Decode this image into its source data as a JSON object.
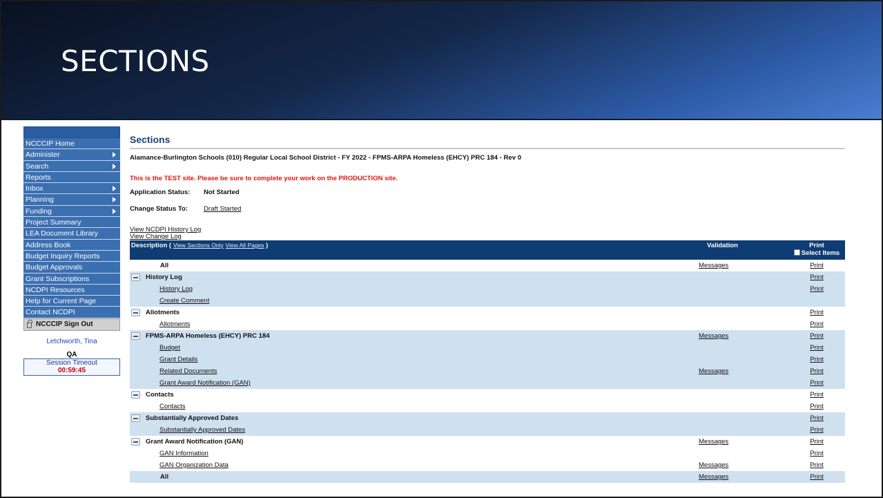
{
  "banner": {
    "title": "SECTIONS"
  },
  "sidebar": {
    "items": [
      {
        "label": "NCCCIP Home",
        "arrow": false
      },
      {
        "label": "Administer",
        "arrow": true
      },
      {
        "label": "Search",
        "arrow": true
      },
      {
        "label": "Reports",
        "arrow": false
      },
      {
        "label": "Inbox",
        "arrow": true
      },
      {
        "label": "Planning",
        "arrow": true
      },
      {
        "label": "Funding",
        "arrow": true
      },
      {
        "label": "Project Summary",
        "arrow": false
      },
      {
        "label": "LEA Document Library",
        "arrow": false
      },
      {
        "label": "Address Book",
        "arrow": false
      },
      {
        "label": "Budget Inquiry Reports",
        "arrow": false
      },
      {
        "label": "Budget Approvals",
        "arrow": false
      },
      {
        "label": "Grant Subscriptions",
        "arrow": false
      },
      {
        "label": "NCDPI Resources",
        "arrow": false
      },
      {
        "label": "Help for Current Page",
        "arrow": false
      },
      {
        "label": "Contact NCDPI",
        "arrow": false
      }
    ],
    "sign_out": "NCCCIP Sign Out",
    "user": "Letchworth, Tina",
    "env": "QA",
    "session_label": "Session Timeout",
    "session_time": "00:59:45"
  },
  "main": {
    "title": "Sections",
    "subtitle": "Alamance-Burlington Schools (010) Regular Local School District - FY 2022 - FPMS-ARPA Homeless (EHCY) PRC 184 - Rev 0",
    "test_warning": "This is the TEST site. Please be sure to complete your work on the PRODUCTION site.",
    "app_status_label": "Application Status:",
    "app_status_value": "Not Started",
    "change_status_label": "Change Status To:",
    "change_status_link": "Draft Started",
    "history_log_link": "View NCDPI History Log",
    "change_log_link": "View Change Log"
  },
  "table": {
    "headers": {
      "description": "Description",
      "view_sections_only": "View Sections Only",
      "view_all_pages": "View All Pages",
      "validation": "Validation",
      "print": "Print",
      "select_items": "Select Items"
    },
    "rows": [
      {
        "kind": "all",
        "label": "All",
        "validation": "Messages",
        "print": "Print",
        "bg": "white"
      },
      {
        "kind": "section",
        "label": "History Log",
        "validation": "",
        "print": "Print",
        "bg": "blue"
      },
      {
        "kind": "page",
        "label": "History Log",
        "validation": "",
        "print": "Print",
        "bg": "blue"
      },
      {
        "kind": "page",
        "label": "Create Comment",
        "validation": "",
        "print": "",
        "bg": "blue"
      },
      {
        "kind": "section",
        "label": "Allotments",
        "validation": "",
        "print": "Print",
        "bg": "white"
      },
      {
        "kind": "page",
        "label": "Allotments",
        "validation": "",
        "print": "Print",
        "bg": "white"
      },
      {
        "kind": "section",
        "label": "FPMS-ARPA Homeless (EHCY) PRC 184",
        "validation": "Messages",
        "print": "Print",
        "bg": "blue"
      },
      {
        "kind": "page",
        "label": "Budget",
        "validation": "",
        "print": "Print",
        "bg": "blue"
      },
      {
        "kind": "page",
        "label": "Grant Details",
        "validation": "",
        "print": "Print",
        "bg": "blue"
      },
      {
        "kind": "page",
        "label": "Related Documents",
        "validation": "Messages",
        "print": "Print",
        "bg": "blue"
      },
      {
        "kind": "page",
        "label": "Grant Award Notification (GAN)",
        "validation": "",
        "print": "Print",
        "bg": "blue"
      },
      {
        "kind": "section",
        "label": "Contacts",
        "validation": "",
        "print": "Print",
        "bg": "white"
      },
      {
        "kind": "page",
        "label": "Contacts",
        "validation": "",
        "print": "Print",
        "bg": "white"
      },
      {
        "kind": "section",
        "label": "Substantially Approved Dates",
        "validation": "",
        "print": "Print",
        "bg": "blue"
      },
      {
        "kind": "page",
        "label": "Substantially Approved Dates",
        "validation": "",
        "print": "Print",
        "bg": "blue"
      },
      {
        "kind": "section",
        "label": "Grant Award Notification (GAN)",
        "validation": "Messages",
        "print": "Print",
        "bg": "white"
      },
      {
        "kind": "page",
        "label": "GAN Information",
        "validation": "",
        "print": "Print",
        "bg": "white"
      },
      {
        "kind": "page",
        "label": "GAN Organization Data",
        "validation": "Messages",
        "print": "Print",
        "bg": "white"
      },
      {
        "kind": "all",
        "label": "All",
        "validation": "Messages",
        "print": "Print",
        "bg": "blue"
      }
    ]
  }
}
